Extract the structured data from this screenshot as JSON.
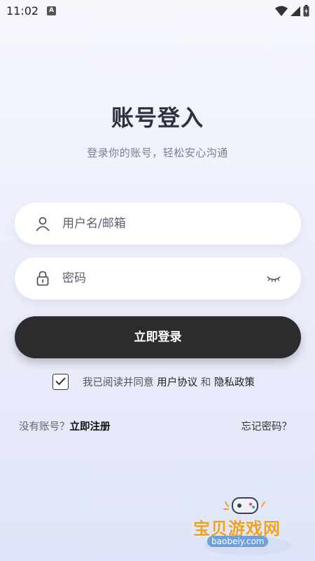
{
  "status_bar": {
    "time": "11:02",
    "notification_letter": "A"
  },
  "header": {
    "title": "账号登入",
    "subtitle": "登录你的账号，轻松安心沟通"
  },
  "form": {
    "username": {
      "placeholder": "用户名/邮箱",
      "icon": "user-icon"
    },
    "password": {
      "placeholder": "密码",
      "icon": "lock-icon",
      "toggle_icon": "eye-closed-icon"
    },
    "submit_label": "立即登录"
  },
  "agreement": {
    "checked": true,
    "prefix": "我已阅读并同意 ",
    "terms_label": "用户协议",
    "conjunction": " 和 ",
    "privacy_label": "隐私政策"
  },
  "footer": {
    "no_account": "没有账号？",
    "register_label": "立即注册",
    "forgot_label": "忘记密码？"
  },
  "watermark": {
    "text": "宝贝游戏网",
    "url": "baobeiy.com"
  }
}
